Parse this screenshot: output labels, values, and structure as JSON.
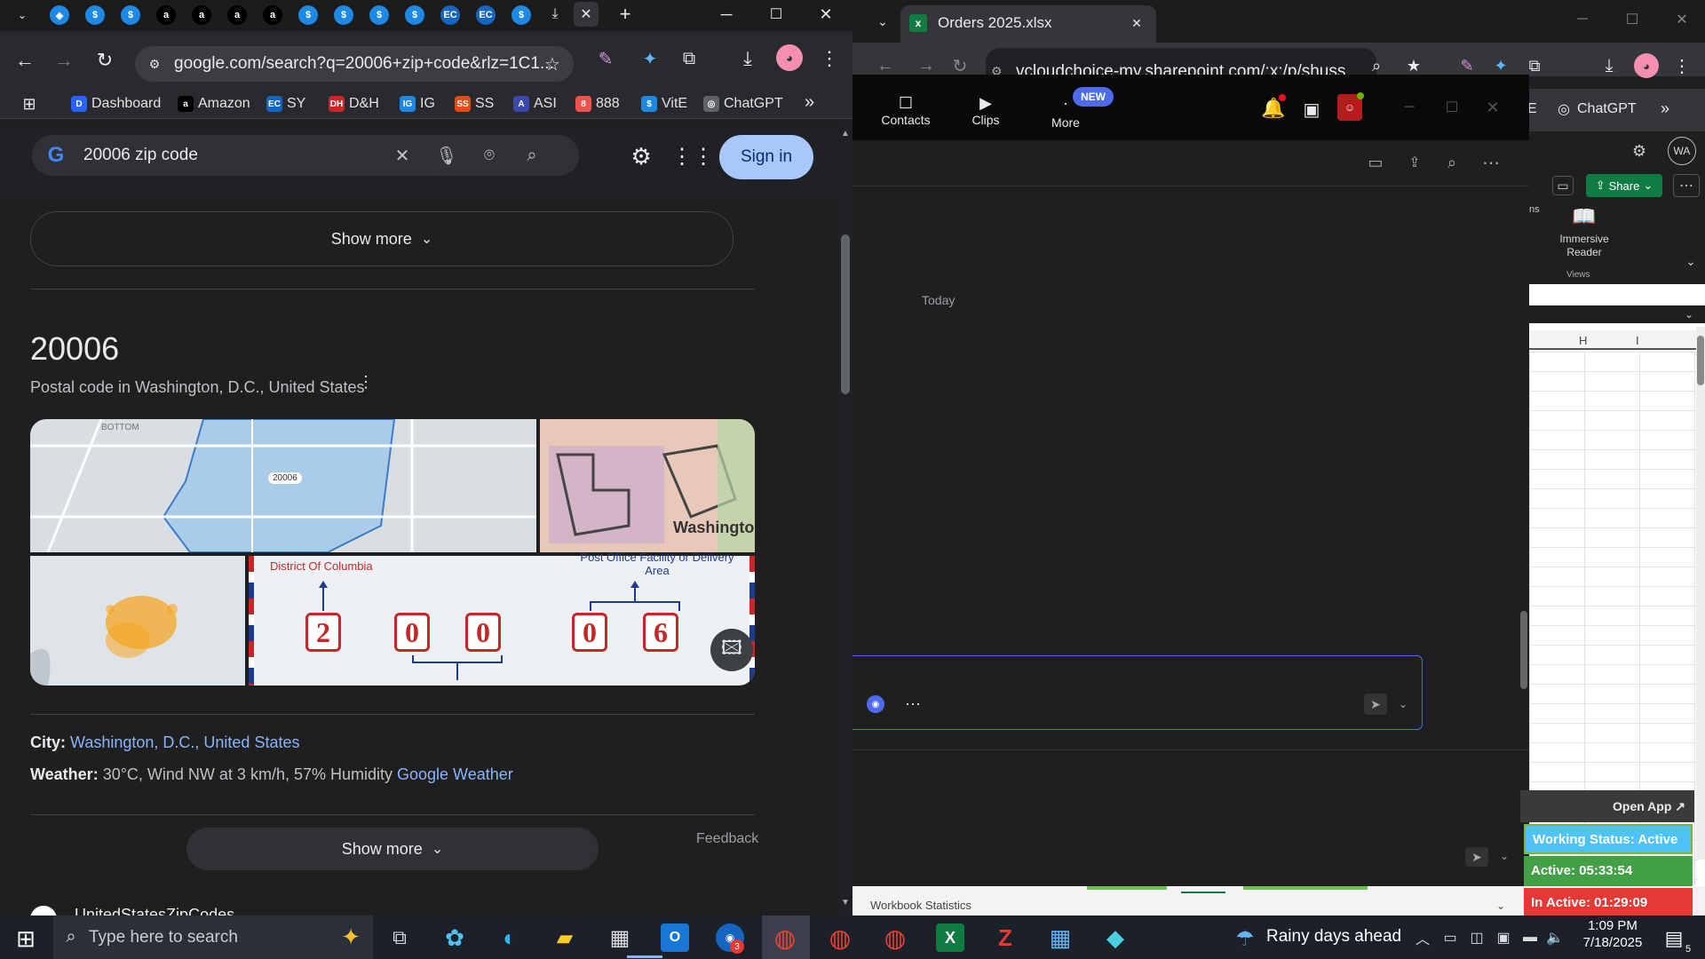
{
  "left_browser": {
    "tabs_badge_colors": [
      "#1e88e5",
      "#1e88e5",
      "#1e88e5",
      "#000000",
      "#000000",
      "#000000",
      "#000000",
      "#1e88e5",
      "#1e88e5",
      "#1e88e5",
      "#1e88e5",
      "#1565c0",
      "#1565c0",
      "#1e88e5"
    ],
    "url": "google.com/search?q=20006+zip+code&rlz=1C1...",
    "bookmarks": [
      {
        "label": "Dashboard",
        "icon": "D",
        "color": "#2962ff"
      },
      {
        "label": "Amazon",
        "icon": "a",
        "color": "#000000"
      },
      {
        "label": "SY",
        "icon": "EC",
        "color": "#1565c0"
      },
      {
        "label": "D&H",
        "icon": "DH",
        "color": "#c62828"
      },
      {
        "label": "IG",
        "icon": "IG",
        "color": "#1e88e5"
      },
      {
        "label": "SS",
        "icon": "SS",
        "color": "#e64a19"
      },
      {
        "label": "ASI",
        "icon": "A",
        "color": "#3949ab"
      },
      {
        "label": "888",
        "icon": "8",
        "color": "#ef5350"
      },
      {
        "label": "VitE",
        "icon": "$",
        "color": "#1e88e5"
      },
      {
        "label": "ChatGPT",
        "icon": "◎",
        "color": "#5f6368"
      }
    ],
    "more_bookmarks": "»",
    "search_query": "20006 zip code",
    "sign_in": "Sign in",
    "show_more_top": "Show more",
    "zip_title": "20006",
    "zip_subtitle": "Postal code in Washington, D.C., United States",
    "map_label_zip": "20006",
    "map_text_bottom": "BOTTOM",
    "map_text_washington": "Washingto",
    "graphic_left_label": "District Of Columbia",
    "graphic_right_label": "Post Office Facility or Delivery Area",
    "graphic_digits": [
      "2",
      "0",
      "0",
      "0",
      "6"
    ],
    "city_label": "City:",
    "city_value": "Washington, D.C., United States",
    "weather_label": "Weather:",
    "weather_value": "30°C, Wind NW at 3 km/h, 57% Humidity",
    "weather_link": "Google Weather",
    "show_more_bottom": "Show more",
    "feedback": "Feedback",
    "next_result": "UnitedStatesZipCodes"
  },
  "right_browser": {
    "tab_title": "Orders 2025.xlsx",
    "url": "vcloudchoice-my.sharepoint.com/:x:/p/shuss",
    "bookmark_chatgpt": "ChatGPT",
    "bookmark_more": "»",
    "bookmark_partial": "E",
    "avatar_initials": "WA",
    "share_label": "Share",
    "immersive_reader": "Immersive Reader",
    "views_label": "Views",
    "ribbon_partial": "ns",
    "col_h": "H",
    "col_i": "I",
    "workbook_stats": "Workbook Statistics"
  },
  "teams": {
    "nav": [
      {
        "label": "Contacts"
      },
      {
        "label": "Clips"
      },
      {
        "label": "More"
      }
    ],
    "new_badge": "NEW",
    "today": "Today"
  },
  "widget": {
    "open_app": "Open App ↗",
    "working_status": "Working Status: Active",
    "active": "Active: 05:33:54",
    "inactive": "In Active: 01:29:09"
  },
  "taskbar": {
    "search_placeholder": "Type here to search",
    "weather": "Rainy days ahead",
    "time": "1:09 PM",
    "date": "7/18/2025",
    "notif_count": "5",
    "outlook_badge": "3"
  }
}
